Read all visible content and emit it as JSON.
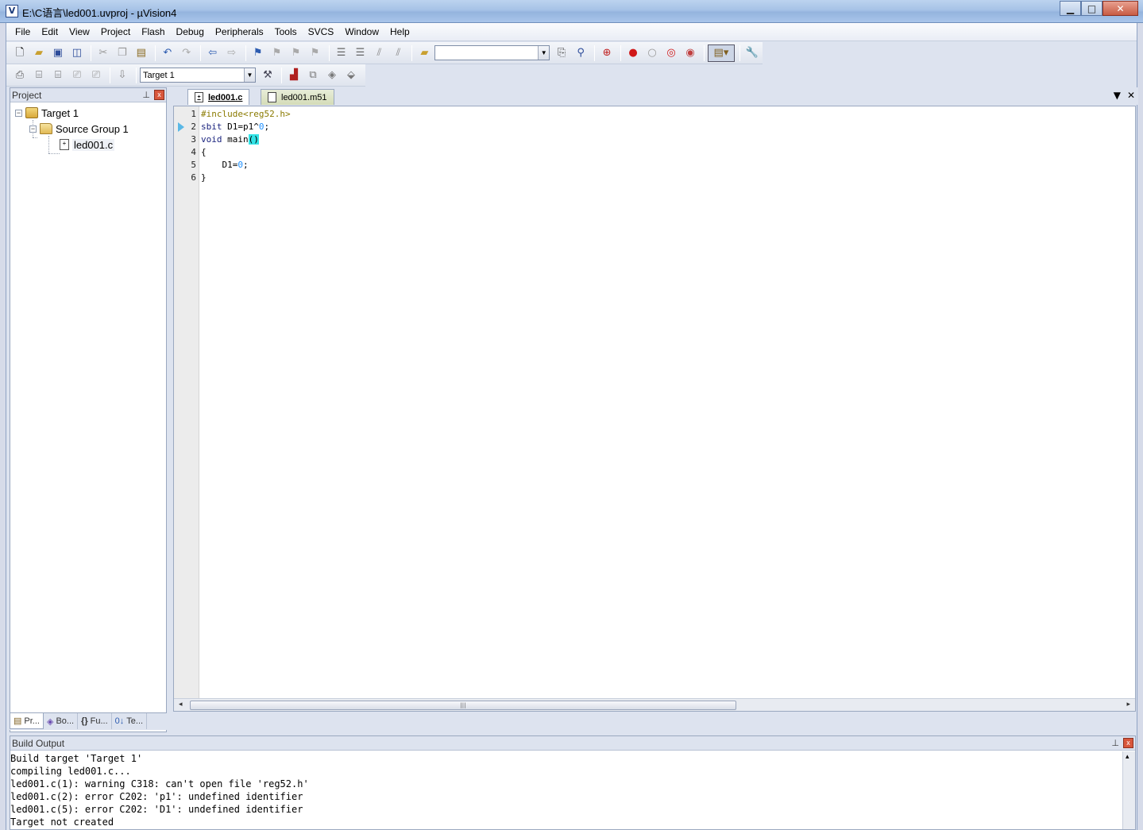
{
  "window": {
    "title": "E:\\C语言\\led001.uvproj - µVision4",
    "app_icon": "uv4-icon",
    "buttons": {
      "minimize": "▁",
      "maximize": "□",
      "close": "✕"
    }
  },
  "menu": [
    "File",
    "Edit",
    "View",
    "Project",
    "Flash",
    "Debug",
    "Peripherals",
    "Tools",
    "SVCS",
    "Window",
    "Help"
  ],
  "toolbar": {
    "find_combo_value": "",
    "target_combo_value": "Target 1"
  },
  "project_panel": {
    "title": "Project",
    "pin": "ᵖ",
    "close": "x",
    "tree": {
      "target": "Target 1",
      "group": "Source Group 1",
      "file": "led001.c"
    },
    "tabs": [
      "Pr...",
      "Bo...",
      "Fu...",
      "Te..."
    ]
  },
  "editor": {
    "tabs": [
      {
        "label": "led001.c",
        "active": true
      },
      {
        "label": "led001.m51",
        "active": false
      }
    ],
    "line_numbers": [
      "1",
      "2",
      "3",
      "4",
      "5",
      "6"
    ],
    "lines": [
      "#include<reg52.h>",
      "sbit D1=p1^0;",
      "void main()",
      "{",
      "    D1=0;",
      "}"
    ]
  },
  "build_output": {
    "title": "Build Output",
    "lines": [
      "Build target 'Target 1'",
      "compiling led001.c...",
      "led001.c(1): warning C318: can't open file 'reg52.h'",
      "led001.c(2): error C202: 'p1': undefined identifier",
      "led001.c(5): error C202: 'D1': undefined identifier",
      "Target not created"
    ]
  },
  "colors": {
    "keyword": "#1a237e",
    "preprocessor": "#8a7a00",
    "number": "#1e90ff",
    "bracket_highlight": "#33e3e6"
  }
}
